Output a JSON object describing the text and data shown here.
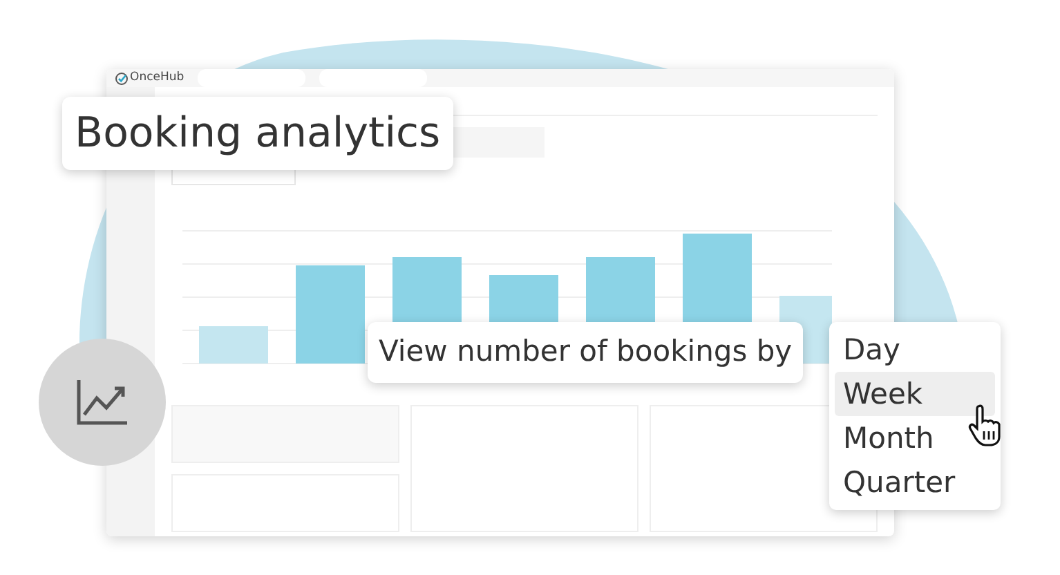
{
  "logo": "OnceHub",
  "title": "Booking analytics",
  "prompt": "View number of bookings by",
  "options": [
    {
      "label": "Day",
      "selected": false
    },
    {
      "label": "Week",
      "selected": true
    },
    {
      "label": "Month",
      "selected": false
    },
    {
      "label": "Quarter",
      "selected": false
    }
  ]
}
